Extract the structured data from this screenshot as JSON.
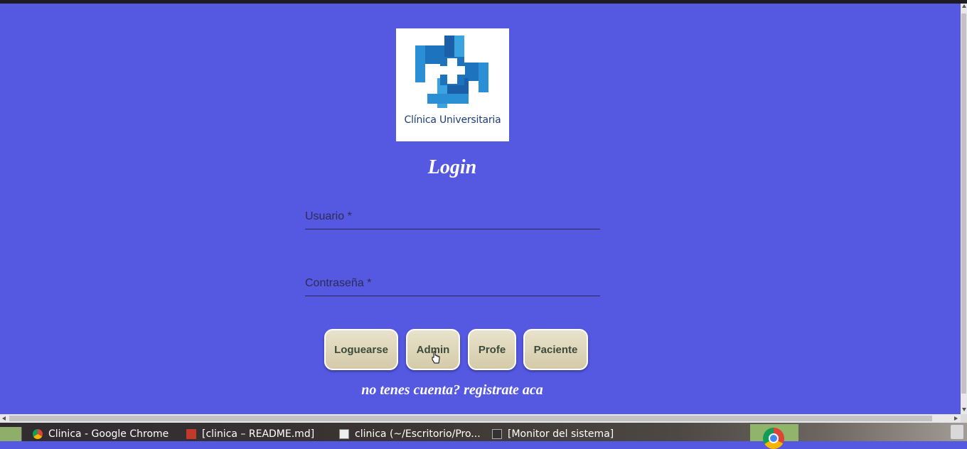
{
  "app": {
    "logo_text": "Clínica Universitaria",
    "title": "Login"
  },
  "form": {
    "username_label": "Usuario *",
    "password_label": "Contraseña *"
  },
  "buttons": {
    "login": "Loguearse",
    "admin": "Admin",
    "profe": "Profe",
    "paciente": "Paciente"
  },
  "register_link": "no tenes cuenta? registrate aca",
  "taskbar": {
    "items": [
      {
        "label": "Clinica - Google Chrome",
        "icon": "chrome-icon"
      },
      {
        "label": "[clinica – README.md]",
        "icon": "editor-icon"
      },
      {
        "label": "clinica (~/Escritorio/Pro...",
        "icon": "text-editor-icon"
      },
      {
        "label": "[Monitor del sistema]",
        "icon": "system-monitor-icon"
      }
    ]
  },
  "colors": {
    "background": "#5558e1",
    "button": "#ddd4b5",
    "text_light": "#ffffff"
  }
}
